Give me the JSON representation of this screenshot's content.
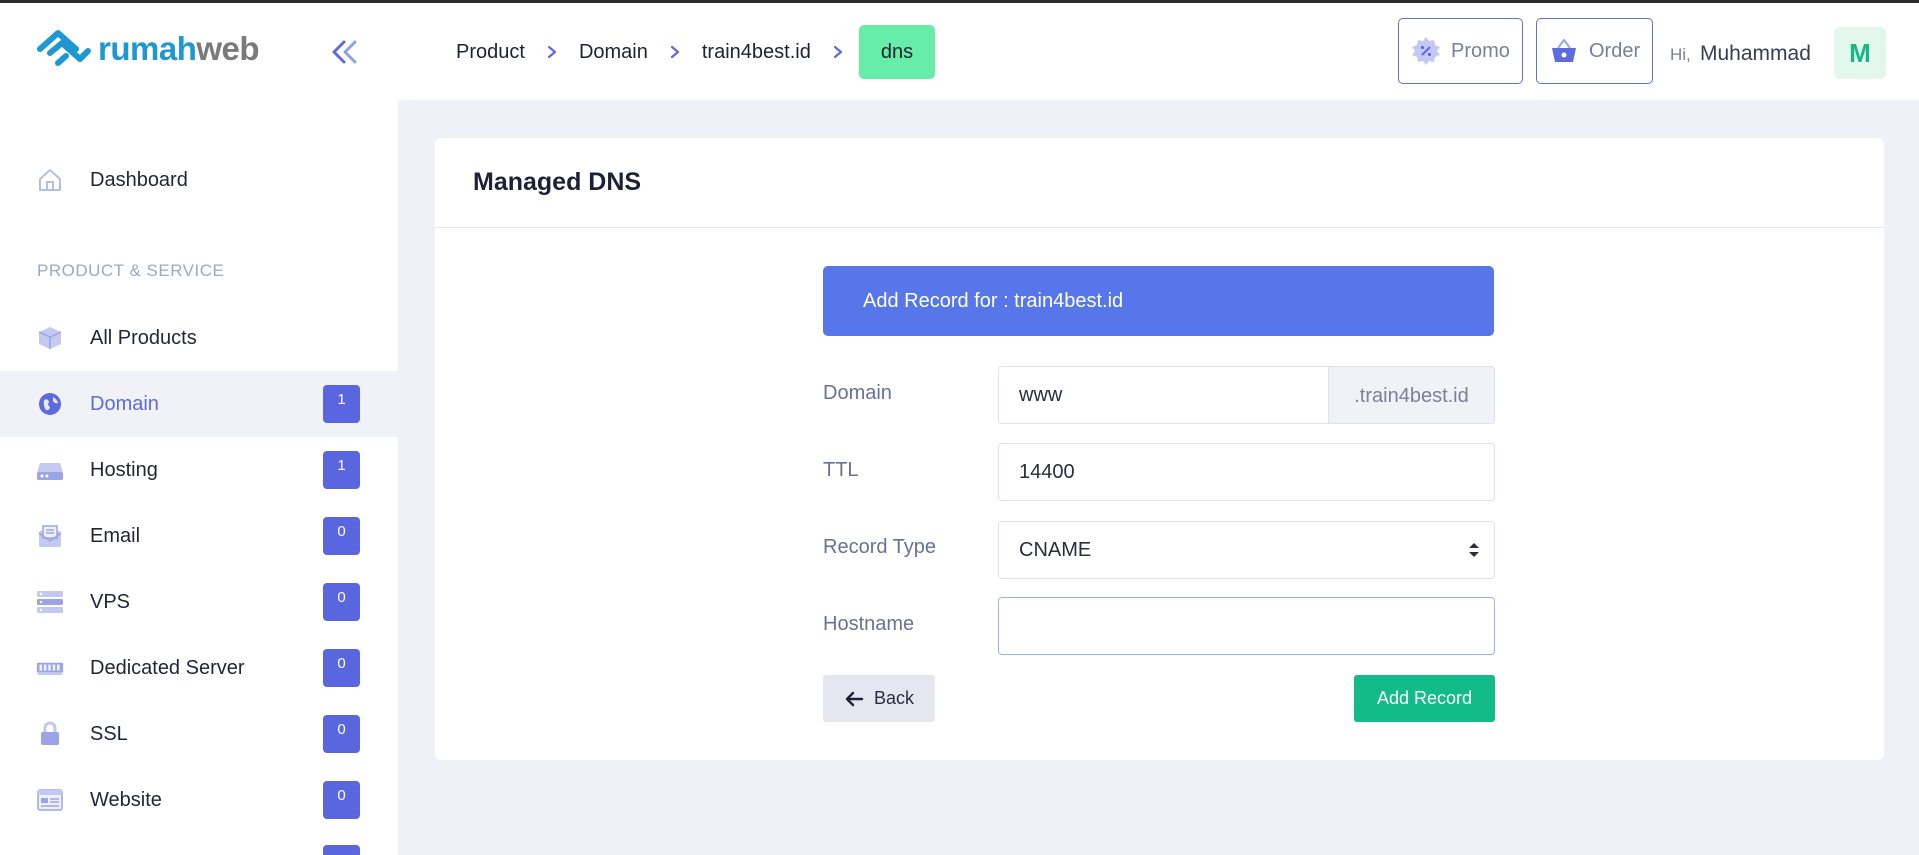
{
  "brand": {
    "part1": "rumah",
    "part2": "web"
  },
  "sidebar": {
    "dashboard": "Dashboard",
    "section_title": "PRODUCT & SERVICE",
    "items": [
      {
        "label": "All Products",
        "badge": null,
        "icon": "box-icon"
      },
      {
        "label": "Domain",
        "badge": "1",
        "icon": "globe-icon",
        "active": true
      },
      {
        "label": "Hosting",
        "badge": "1",
        "icon": "server-drive-icon"
      },
      {
        "label": "Email",
        "badge": "0",
        "icon": "mail-icon"
      },
      {
        "label": "VPS",
        "badge": "0",
        "icon": "server-stack-icon"
      },
      {
        "label": "Dedicated Server",
        "badge": "0",
        "icon": "memory-icon"
      },
      {
        "label": "SSL",
        "badge": "0",
        "icon": "lock-icon"
      },
      {
        "label": "Website",
        "badge": "0",
        "icon": "browser-icon"
      }
    ]
  },
  "breadcrumb": {
    "items": [
      "Product",
      "Domain",
      "train4best.id"
    ],
    "current": "dns"
  },
  "header": {
    "promo": "Promo",
    "order": "Order",
    "greeting": "Hi,",
    "user_name": "Muhammad",
    "avatar_initial": "M"
  },
  "card": {
    "title": "Managed DNS",
    "panel_title": "Add Record for : train4best.id",
    "form": {
      "domain_label": "Domain",
      "domain_value": "www",
      "domain_suffix": ".train4best.id",
      "ttl_label": "TTL",
      "ttl_value": "14400",
      "record_type_label": "Record Type",
      "record_type_value": "CNAME",
      "hostname_label": "Hostname",
      "hostname_value": ""
    },
    "back_button": "Back",
    "add_button": "Add Record"
  },
  "colors": {
    "accent": "#5a66e0",
    "panel": "#5676e9",
    "success": "#12bb87",
    "crumb_active": "#66eda8"
  }
}
